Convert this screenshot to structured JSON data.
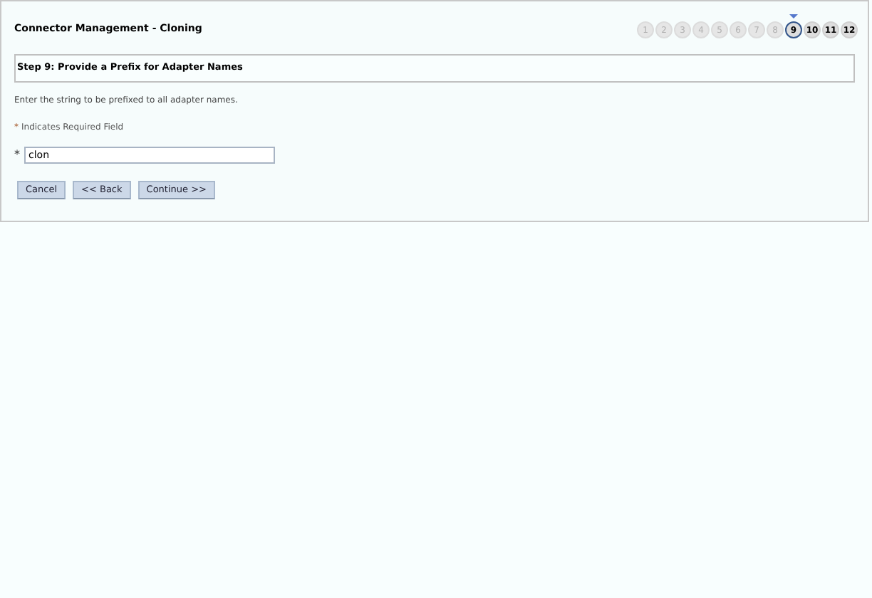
{
  "title": "Connector Management - Cloning",
  "steps": [
    {
      "label": "1",
      "selected": false,
      "disabled": true
    },
    {
      "label": "2",
      "selected": false,
      "disabled": true
    },
    {
      "label": "3",
      "selected": false,
      "disabled": true
    },
    {
      "label": "4",
      "selected": false,
      "disabled": true
    },
    {
      "label": "5",
      "selected": false,
      "disabled": true
    },
    {
      "label": "6",
      "selected": false,
      "disabled": true
    },
    {
      "label": "7",
      "selected": false,
      "disabled": true
    },
    {
      "label": "8",
      "selected": false,
      "disabled": true
    },
    {
      "label": "9",
      "selected": true,
      "disabled": false
    },
    {
      "label": "10",
      "selected": false,
      "disabled": false
    },
    {
      "label": "11",
      "selected": false,
      "disabled": false
    },
    {
      "label": "12",
      "selected": false,
      "disabled": false
    }
  ],
  "section_title": "Step 9: Provide a Prefix for Adapter Names",
  "instruction": "Enter the string to be prefixed to all adapter names.",
  "required_note": {
    "mark": "*",
    "text": "Indicates Required Field"
  },
  "field": {
    "mark": "*",
    "value": "clon"
  },
  "buttons": [
    "Cancel",
    "<< Back",
    "Continue >>"
  ]
}
